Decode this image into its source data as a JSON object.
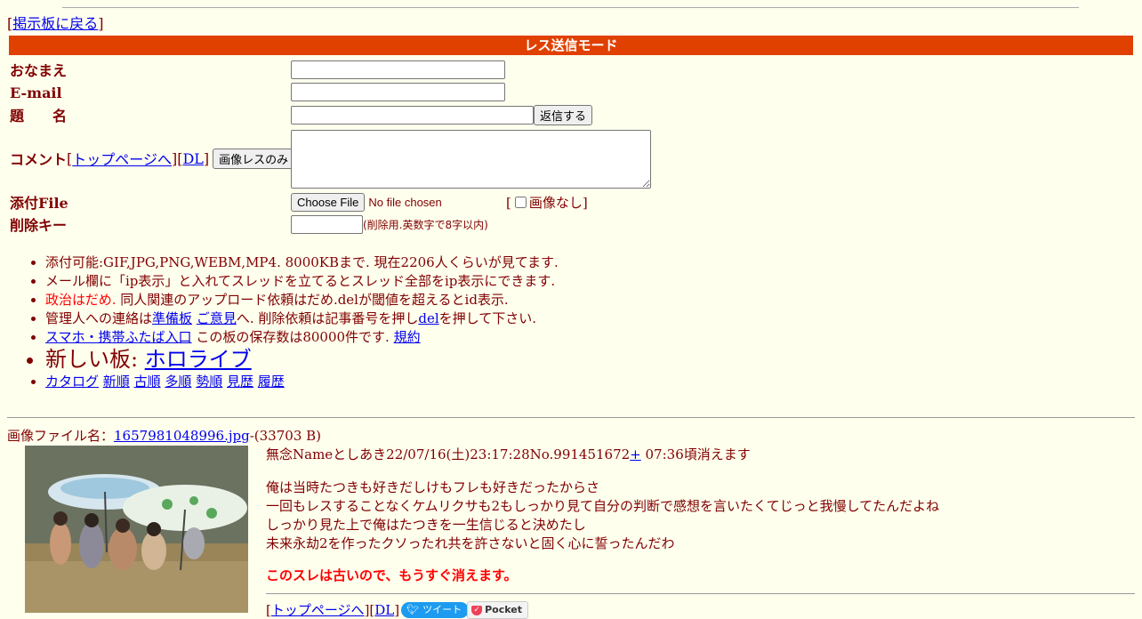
{
  "nav": {
    "open_bracket": "[",
    "back_link": "掲示板に戻る",
    "close_bracket": "]"
  },
  "form": {
    "mode_title": "レス送信モード",
    "name_label": "おなまえ",
    "email_label": "E-mail",
    "subject_label": "題　　名",
    "submit_label": "返信する",
    "comment_label": "コメント",
    "toppage_link": "トップページへ",
    "dl_link": "DL",
    "image_only_button": "画像レスのみ",
    "attach_label": "添付File",
    "choose_file_button": "Choose File",
    "no_file_text": "No file chosen",
    "no_image_label": "画像なし",
    "delete_key_label": "削除キー",
    "delete_key_hint": "(削除用.英数字で8字以内)"
  },
  "rules": {
    "r1": "添付可能:GIF,JPG,PNG,WEBM,MP4. 8000KBまで. 現在2206人くらいが見てます.",
    "r2": "メール欄に「ip表示」と入れてスレッドを立てるとスレッド全部をip表示にできます.",
    "r3_red": "政治はだめ.",
    "r3_rest": " 同人関連のアップロード依頼はだめ.delが閾値を超えるとid表示.",
    "r4_pre": "管理人への連絡は",
    "r4_link1": "準備板",
    "r4_link2": "ご意見",
    "r4_mid": "へ. 削除依頼は記事番号を押し",
    "r4_link3": "del",
    "r4_post": "を押して下さい.",
    "r5_link": "スマホ・携帯ふたば入口",
    "r5_text": " この板の保存数は80000件です. ",
    "r5_link2": "規約",
    "r6_text": "新しい板: ",
    "r6_link": "ホロライブ",
    "r7": [
      "カタログ",
      "新順",
      "古順",
      "多順",
      "勢順",
      "見歴",
      "履歴"
    ]
  },
  "thread": {
    "file_prefix": "画像ファイル名：",
    "file_name": "1657981048996.jpg",
    "file_size": "-(33703 B)",
    "header": "無念Nameとしあき22/07/16(土)23:17:28No.991451672",
    "plus_link": "+",
    "expire": " 07:36頃消えます",
    "body": [
      "俺は当時たつきも好きだしけもフレも好きだったからさ",
      "一回もレスすることなくケムリクサも2もしっかり見て自分の判断で感想を言いたくてじっと我慢してたんだよね",
      "しっかり見た上で俺はたつきを一生信じると決めたし",
      "未来永劫2を作ったクソったれ共を許さないと固く心に誓ったんだわ"
    ],
    "warning": "このスレは古いので、もうすぐ消えます。",
    "tweet_label": "ツイート",
    "pocket_label": "Pocket"
  },
  "colors": {
    "bg": "#ffffee",
    "text": "#800000",
    "mode_bar": "#e04000",
    "link": "#0000ee",
    "warning": "#ff0000"
  }
}
